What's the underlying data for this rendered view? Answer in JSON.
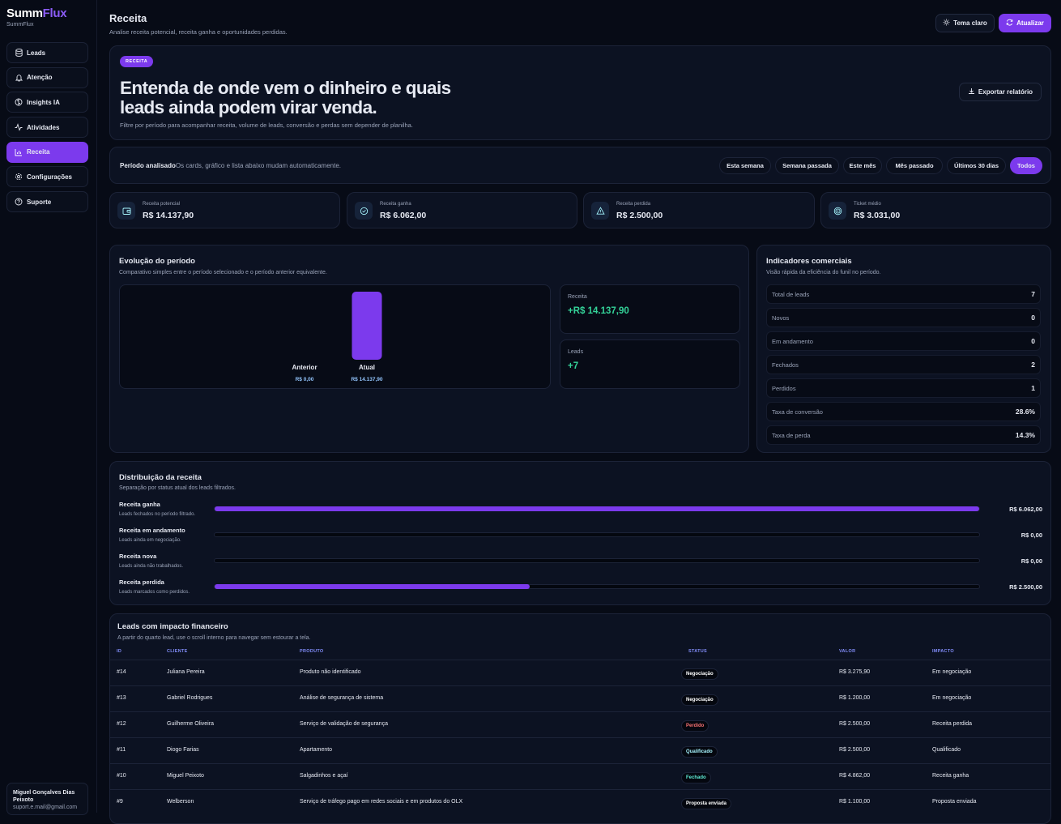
{
  "app": {
    "brand_a": "Summ",
    "brand_b": "Flux",
    "brand_sub": "SummFlux"
  },
  "sidebar": {
    "items": [
      {
        "label": "Leads",
        "icon": "database-icon"
      },
      {
        "label": "Atenção",
        "icon": "bell-icon"
      },
      {
        "label": "Insights IA",
        "icon": "brain-icon"
      },
      {
        "label": "Atividades",
        "icon": "activity-icon"
      },
      {
        "label": "Receita",
        "icon": "bar-chart-icon",
        "active": true
      },
      {
        "label": "Configurações",
        "icon": "gear-icon"
      },
      {
        "label": "Suporte",
        "icon": "help-icon"
      }
    ],
    "user": {
      "name": "Miguel Gonçalves Dias Peixoto",
      "email": "suport.e.mail@gmail.com"
    }
  },
  "header": {
    "title": "Receita",
    "subtitle": "Analise receita potencial, receita ganha e oportunidades perdidas.",
    "theme_button": "Tema claro",
    "refresh_button": "Atualizar"
  },
  "hero": {
    "badge": "RECEITA",
    "title": "Entenda de onde vem o dinheiro e quais leads ainda podem virar venda.",
    "description": "Filtre por período para acompanhar receita, volume de leads, conversão e perdas sem depender de planilha.",
    "export_button": "Exportar relatório"
  },
  "period": {
    "label": "Período analisado",
    "description": "Os cards, gráfico e lista abaixo mudam automaticamente.",
    "options": [
      "Esta semana",
      "Semana passada",
      "Este mês",
      "Mês passado",
      "Últimos 30 dias",
      "Todos"
    ],
    "selected": "Todos"
  },
  "stats": [
    {
      "label": "Receita potencial",
      "value": "R$ 14.137,90",
      "icon": "wallet-icon"
    },
    {
      "label": "Receita ganha",
      "value": "R$ 6.062,00",
      "icon": "check-circle-icon"
    },
    {
      "label": "Receita perdida",
      "value": "R$ 2.500,00",
      "icon": "alert-triangle-icon"
    },
    {
      "label": "Ticket médio",
      "value": "R$ 3.031,00",
      "icon": "target-icon"
    }
  ],
  "evolution": {
    "title": "Evolução do período",
    "subtitle": "Comparativo simples entre o período selecionado e o período anterior equivalente.",
    "kpis": [
      {
        "label": "Receita",
        "value": "+R$ 14.137,90"
      },
      {
        "label": "Leads",
        "value": "+7"
      }
    ]
  },
  "chart_data": {
    "type": "bar",
    "categories": [
      "Anterior",
      "Atual"
    ],
    "values": [
      0,
      14137.9
    ],
    "value_labels": [
      "R$ 0,00",
      "R$ 14.137,90"
    ],
    "bar_color": "#7c3aed"
  },
  "indicators": {
    "title": "Indicadores comerciais",
    "subtitle": "Visão rápida da eficiência do funil no período.",
    "rows": [
      {
        "label": "Total de leads",
        "value": "7"
      },
      {
        "label": "Novos",
        "value": "0"
      },
      {
        "label": "Em andamento",
        "value": "0"
      },
      {
        "label": "Fechados",
        "value": "2"
      },
      {
        "label": "Perdidos",
        "value": "1"
      },
      {
        "label": "Taxa de conversão",
        "value": "28.6%"
      },
      {
        "label": "Taxa de perda",
        "value": "14.3%"
      }
    ]
  },
  "distribution": {
    "title": "Distribuição da receita",
    "subtitle": "Separação por status atual dos leads filtrados.",
    "rows": [
      {
        "label": "Receita ganha",
        "desc": "Leads fechados no período filtrado.",
        "value": "R$ 6.062,00",
        "fraction": 1.0
      },
      {
        "label": "Receita em andamento",
        "desc": "Leads ainda em negociação.",
        "value": "R$ 0,00",
        "fraction": 0
      },
      {
        "label": "Receita nova",
        "desc": "Leads ainda não trabalhados.",
        "value": "R$ 0,00",
        "fraction": 0
      },
      {
        "label": "Receita perdida",
        "desc": "Leads marcados como perdidos.",
        "value": "R$ 2.500,00",
        "fraction": 0.412
      }
    ]
  },
  "leads_table": {
    "title": "Leads com impacto financeiro",
    "subtitle": "A partir do quarto lead, use o scroll interno para navegar sem estourar a tela.",
    "columns": [
      "ID",
      "CLIENTE",
      "PRODUTO",
      "STATUS",
      "VALOR",
      "IMPACTO"
    ],
    "rows": [
      {
        "id": "#14",
        "client": "Juliana Pereira",
        "product": "Produto não identificado",
        "status": "Negociação",
        "value": "R$ 3.275,90",
        "impact": "Em negociação"
      },
      {
        "id": "#13",
        "client": "Gabriel Rodrigues",
        "product": "Análise de segurança de sistema",
        "status": "Negociação",
        "value": "R$ 1.200,00",
        "impact": "Em negociação"
      },
      {
        "id": "#12",
        "client": "Guilherme Oliveira",
        "product": "Serviço de validação de segurança",
        "status": "Perdido",
        "value": "R$ 2.500,00",
        "impact": "Receita perdida"
      },
      {
        "id": "#11",
        "client": "Diogo Farias",
        "product": "Apartamento",
        "status": "Qualificado",
        "value": "R$ 2.500,00",
        "impact": "Qualificado"
      },
      {
        "id": "#10",
        "client": "Miguel Peixoto",
        "product": "Salgadinhos e açaí",
        "status": "Fechado",
        "value": "R$ 4.862,00",
        "impact": "Receita ganha"
      },
      {
        "id": "#9",
        "client": "Welberson",
        "product": "Serviço de tráfego pago em redes sociais e em produtos do OLX",
        "status": "Proposta enviada",
        "value": "R$ 1.100,00",
        "impact": "Proposta enviada"
      }
    ]
  },
  "colors": {
    "accent": "#7c3aed",
    "positive": "#34d399",
    "lost": "#f87171",
    "qualified": "#a5f3fc",
    "closed": "#5eead4",
    "table_header": "#818cf8"
  }
}
